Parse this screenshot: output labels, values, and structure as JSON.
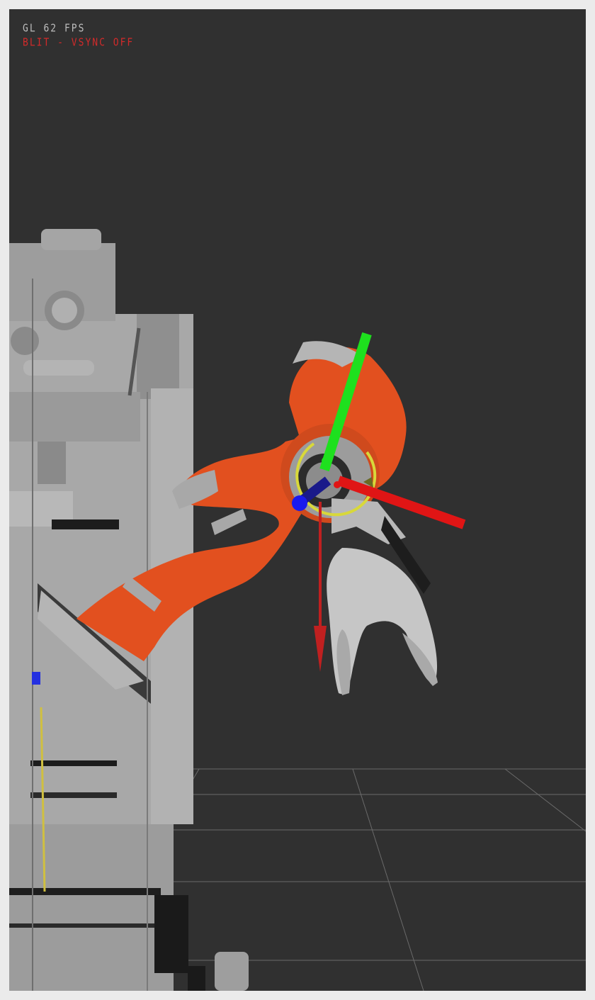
{
  "hud": {
    "fps_text": "GL 62 FPS",
    "blit_text": "BLIT - VSYNC OFF"
  },
  "colors": {
    "frame": "#ebebeb",
    "viewport_background": "#303030",
    "grid_line": "#6a6a6a",
    "robot_arm_orange": "#e2501f",
    "robot_arm_gray": "#9a9a9a",
    "platform_gray": "#a9a9a9",
    "hand_gray": "#c6c6c6",
    "axis_x_red": "#e01515",
    "axis_y_green": "#1ee01e",
    "axis_z_blue": "#1a1aee",
    "ring_yellow": "#d8d83a",
    "fps_text_color": "#bdbdbd",
    "blit_text_color": "#d22a2a"
  },
  "scene": {
    "objects": [
      "floor-grid",
      "robot-platform",
      "robot-arm",
      "robotic-hand",
      "interactive-marker-axes",
      "rotation-ring"
    ]
  }
}
